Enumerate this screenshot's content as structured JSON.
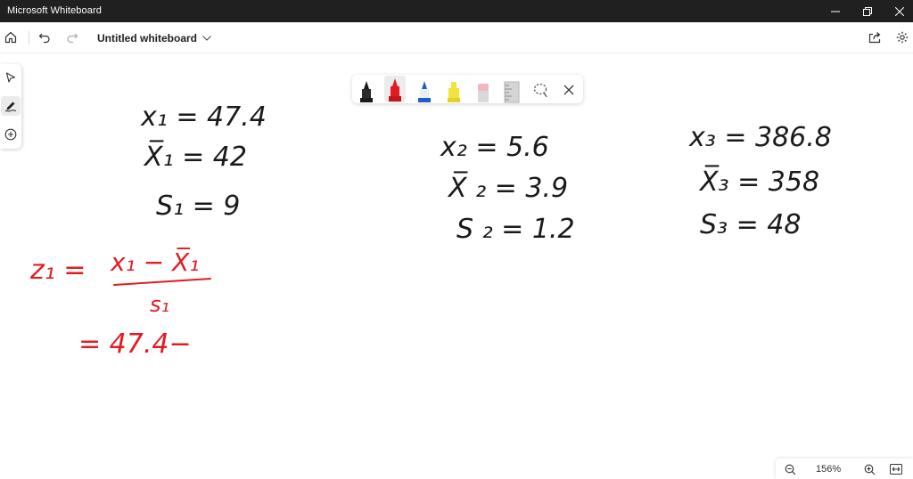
{
  "window": {
    "app_title": "Microsoft Whiteboard",
    "controls": [
      "minimize",
      "restore",
      "close"
    ]
  },
  "header": {
    "home_icon": "home-icon",
    "undo_icon": "undo-icon",
    "redo_icon": "redo-icon",
    "doc_title": "Untitled whiteboard",
    "share_icon": "share-icon",
    "settings_icon": "gear-icon"
  },
  "left_toolbar": {
    "tools": [
      {
        "name": "select",
        "icon": "pointer-icon"
      },
      {
        "name": "ink",
        "icon": "pen-squiggle-icon",
        "active": true
      },
      {
        "name": "add",
        "icon": "plus-circle-icon"
      }
    ]
  },
  "pen_toolbar": {
    "tools": [
      {
        "name": "black pen",
        "color": "#1a1a1a"
      },
      {
        "name": "red pen",
        "color": "#e31b23",
        "active": true
      },
      {
        "name": "blue pen",
        "color": "#1f5fbf"
      },
      {
        "name": "yellow highlighter",
        "color": "#f2e33a"
      },
      {
        "name": "eraser",
        "color": "#f0b6bc"
      },
      {
        "name": "ruler",
        "color": "#c8c8c8"
      },
      {
        "name": "lasso",
        "color": "#6b6b6b"
      }
    ],
    "close_icon": "close-icon"
  },
  "canvas": {
    "ink": {
      "black": "#1a1a1a",
      "red": "#e31b23"
    },
    "handwriting": {
      "x1": "x₁ = 47.4",
      "xbar1": "X̅₁ = 42",
      "s1": "S₁ = 9",
      "x2": "x₂ = 5.6",
      "xbar2": "X̅ ₂ = 3.9",
      "s2": "S ₂ = 1.2",
      "x3": "x₃ = 386.8",
      "xbar3": "X̅₃ = 358",
      "s3": "S₃ = 48",
      "z1_lhs": "z₁ =",
      "z1_numerator": "x₁ − X̅₁",
      "z1_denominator": "s₁",
      "z1_sub": "= 47.4−"
    }
  },
  "zoom": {
    "zoom_out_icon": "zoom-out-icon",
    "level": "156%",
    "zoom_in_icon": "zoom-in-icon",
    "fit_icon": "fit-screen-icon"
  }
}
